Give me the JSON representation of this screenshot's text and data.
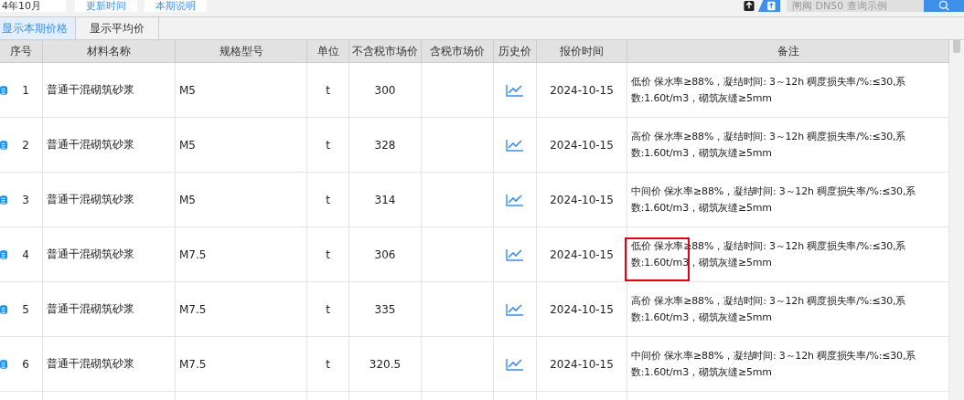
{
  "toolbar": {
    "period": "4年10月",
    "buttons": [
      "更新时间",
      "本期说明"
    ],
    "search": {
      "placeholder": "闸阀 DN50 查询示例"
    }
  },
  "tabs": [
    {
      "label": "显示本期价格",
      "selected": true
    },
    {
      "label": "显示平均价",
      "selected": false
    }
  ],
  "table": {
    "columns": [
      "序号",
      "材料名称",
      "规格型号",
      "单位",
      "不含税市场价",
      "含税市场价",
      "历史价",
      "报价时间",
      "备注"
    ],
    "rows": [
      {
        "no": "1",
        "name": "普通干混砌筑砂浆",
        "spec": "M5",
        "unit": "t",
        "price": "300",
        "date": "2024-10-15",
        "remark": "低价 保水率≥88%，凝结时间: 3～12h 稠度损失率/%:≤30,系数:1.60t/m3，砌筑灰缝≥5mm",
        "highlighted": false
      },
      {
        "no": "2",
        "name": "普通干混砌筑砂浆",
        "spec": "M5",
        "unit": "t",
        "price": "328",
        "date": "2024-10-15",
        "remark": "高价 保水率≥88%，凝结时间: 3～12h 稠度损失率/%:≤30,系数:1.60t/m3，砌筑灰缝≥5mm",
        "highlighted": false
      },
      {
        "no": "3",
        "name": "普通干混砌筑砂浆",
        "spec": "M5",
        "unit": "t",
        "price": "314",
        "date": "2024-10-15",
        "remark": "中间价 保水率≥88%，凝结时间: 3～12h 稠度损失率/%:≤30,系数:1.60t/m3，砌筑灰缝≥5mm",
        "highlighted": false
      },
      {
        "no": "4",
        "name": "普通干混砌筑砂浆",
        "spec": "M7.5",
        "unit": "t",
        "price": "306",
        "date": "2024-10-15",
        "remark": "低价 保水率≥88%，凝结时间: 3～12h 稠度损失率/%:≤30,系数:1.60t/m3，砌筑灰缝≥5mm",
        "highlighted": true
      },
      {
        "no": "5",
        "name": "普通干混砌筑砂浆",
        "spec": "M7.5",
        "unit": "t",
        "price": "335",
        "date": "2024-10-15",
        "remark": "高价 保水率≥88%，凝结时间: 3～12h 稠度损失率/%:≤30,系数:1.60t/m3，砌筑灰缝≥5mm",
        "highlighted": false
      },
      {
        "no": "6",
        "name": "普通干混砌筑砂浆",
        "spec": "M7.5",
        "unit": "t",
        "price": "320.5",
        "date": "2024-10-15",
        "remark": "中间价 保水率≥88%，凝结时间: 3～12h 稠度损失率/%:≤30,系数:1.60t/m3，砌筑灰缝≥5mm",
        "highlighted": false
      }
    ]
  }
}
